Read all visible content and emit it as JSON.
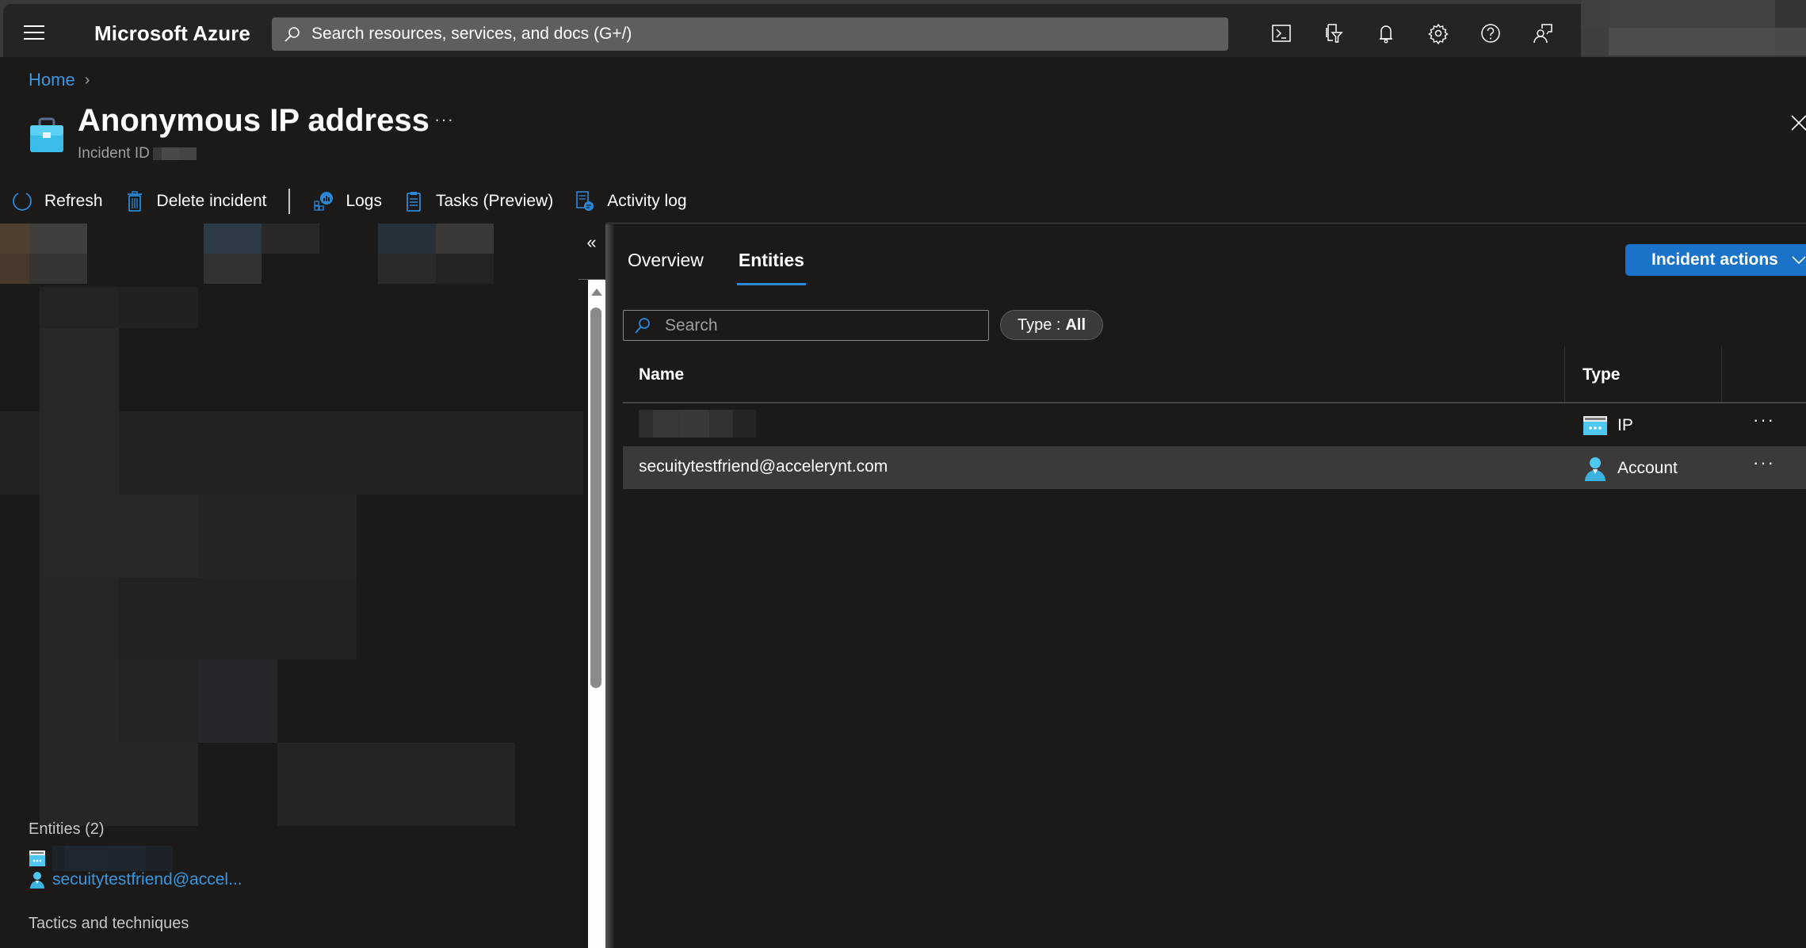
{
  "topbar": {
    "brand": "Microsoft Azure",
    "search_placeholder": "Search resources, services, and docs (G+/)",
    "icons": [
      "cloud-shell-icon",
      "directory-filter-icon",
      "notifications-icon",
      "settings-icon",
      "help-icon",
      "feedback-icon"
    ]
  },
  "breadcrumb": {
    "items": [
      {
        "label": "Home"
      }
    ],
    "separator": ">"
  },
  "header": {
    "title": "Anonymous IP address",
    "more": "···",
    "incident_id_label": "Incident ID",
    "close": "×"
  },
  "toolbar": {
    "refresh": "Refresh",
    "delete": "Delete incident",
    "logs": "Logs",
    "tasks": "Tasks (Preview)",
    "activity_log": "Activity log"
  },
  "left_pane": {
    "collapse": "«",
    "entities_title": "Entities (2)",
    "entities": [
      {
        "type": "IP",
        "label": ""
      },
      {
        "type": "Account",
        "label": "secuitytestfriend@accel..."
      }
    ],
    "tactics_title": "Tactics and techniques"
  },
  "right_pane": {
    "tabs": [
      {
        "label": "Overview",
        "active": false
      },
      {
        "label": "Entities",
        "active": true
      }
    ],
    "incident_actions": "Incident actions",
    "search_placeholder": "Search",
    "type_filter_label": "Type :",
    "type_filter_value": "All",
    "table": {
      "columns": [
        "Name",
        "Type"
      ],
      "rows": [
        {
          "name": "",
          "type": "IP",
          "more": "···",
          "selected": false
        },
        {
          "name": "secuitytestfriend@accelerynt.com",
          "type": "Account",
          "more": "···",
          "selected": true
        }
      ]
    }
  },
  "colors": {
    "accent": "#1a73c9",
    "link": "#3a96dd",
    "background": "#1b1a19",
    "topbar": "#252423",
    "selected_row": "#3b3a39",
    "entity_icon": "#50c7f0"
  }
}
